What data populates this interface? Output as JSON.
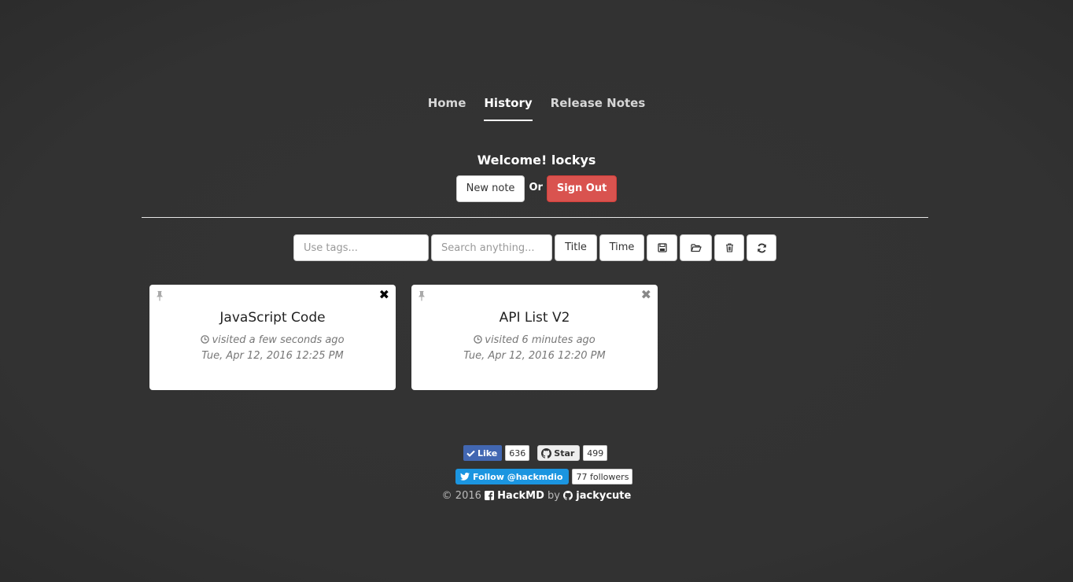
{
  "nav": {
    "items": [
      {
        "label": "Home",
        "active": false
      },
      {
        "label": "History",
        "active": true
      },
      {
        "label": "Release Notes",
        "active": false
      }
    ]
  },
  "welcome": {
    "text": "Welcome! lockys",
    "new_note_label": "New note",
    "or_label": "Or",
    "sign_out_label": "Sign Out"
  },
  "toolbar": {
    "tags_placeholder": "Use tags...",
    "search_placeholder": "Search anything...",
    "title_label": "Title",
    "time_label": "Time",
    "icons": [
      "save-icon",
      "folder-open-icon",
      "trash-icon",
      "refresh-icon"
    ]
  },
  "history": [
    {
      "title": "JavaScript Code",
      "visited": "visited a few seconds ago",
      "date": "Tue, Apr 12, 2016 12:25 PM"
    },
    {
      "title": "API List V2",
      "visited": "visited 6 minutes ago",
      "date": "Tue, Apr 12, 2016 12:20 PM"
    }
  ],
  "social": {
    "like_label": "Like",
    "like_count": "636",
    "star_label": "Star",
    "star_count": "499",
    "follow_label": "Follow @hackmdio",
    "followers": "77 followers"
  },
  "footer": {
    "copyright": "© 2016",
    "brand": "HackMD",
    "by": "by",
    "author": "jackycute"
  },
  "colors": {
    "background": "#333333",
    "danger": "#d9534f",
    "facebook": "#4267b2",
    "twitter": "#1b95e0"
  }
}
